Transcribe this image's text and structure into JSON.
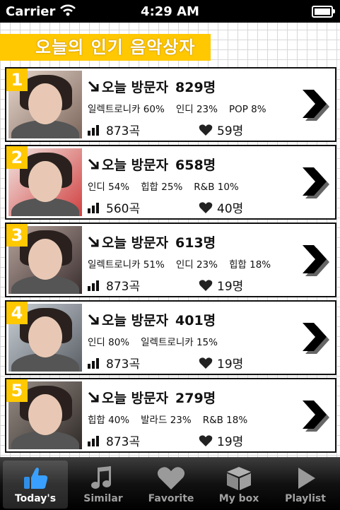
{
  "status_bar": {
    "carrier": "Carrier",
    "time": "4:29 AM"
  },
  "title": "오늘의 인기 음악상자",
  "items": [
    {
      "rank": "1",
      "visitors_label": "오늘 방문자",
      "visitors_count": "829명",
      "genres": [
        "일렉트로니카 60%",
        "인디 23%",
        "POP 8%"
      ],
      "songs": "873곡",
      "likes": "59명"
    },
    {
      "rank": "2",
      "visitors_label": "오늘 방문자",
      "visitors_count": "658명",
      "genres": [
        "인디 54%",
        "힙합 25%",
        "R&B 10%"
      ],
      "songs": "560곡",
      "likes": "40명"
    },
    {
      "rank": "3",
      "visitors_label": "오늘 방문자",
      "visitors_count": "613명",
      "genres": [
        "일렉트로니카 51%",
        "인디 23%",
        "힙합 18%"
      ],
      "songs": "873곡",
      "likes": "19명"
    },
    {
      "rank": "4",
      "visitors_label": "오늘 방문자",
      "visitors_count": "401명",
      "genres": [
        "인디 80%",
        "일렉트로니카 15%"
      ],
      "songs": "873곡",
      "likes": "19명"
    },
    {
      "rank": "5",
      "visitors_label": "오늘 방문자",
      "visitors_count": "279명",
      "genres": [
        "힙합 40%",
        "발라드 23%",
        "R&B 18%"
      ],
      "songs": "873곡",
      "likes": "19명"
    }
  ],
  "tabs": [
    {
      "label": "Today's",
      "icon": "thumbs-up-icon",
      "active": true
    },
    {
      "label": "Similar",
      "icon": "music-note-icon",
      "active": false
    },
    {
      "label": "Favorite",
      "icon": "heart-icon",
      "active": false
    },
    {
      "label": "My box",
      "icon": "box-icon",
      "active": false
    },
    {
      "label": "Playlist",
      "icon": "play-icon",
      "active": false
    }
  ],
  "colors": {
    "accent": "#ffc800",
    "tab_active_icon": "#3aa0ff"
  }
}
